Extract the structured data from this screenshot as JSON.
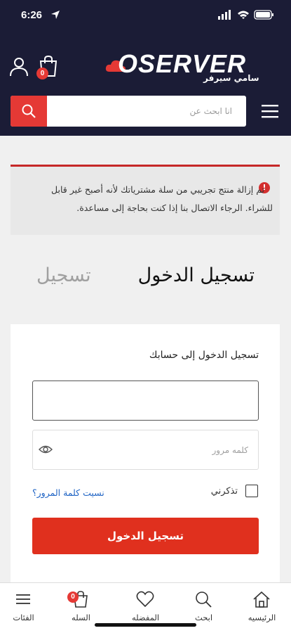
{
  "status_bar": {
    "time": "6:26"
  },
  "header": {
    "logo_text": "OSERVER",
    "logo_subtext": "سامي سيرفر",
    "cart_count": "0",
    "search": {
      "placeholder": "انا ابحث عن"
    },
    "accent_color": "#e53935",
    "bg_color": "#1b1c36"
  },
  "alert": {
    "text": "تم إزالة منتج تجريبي من سلة مشترياتك لأنه أصبح غير قابل للشراء. الرجاء الاتصال بنا إذا كنت بحاجة إلى مساعدة."
  },
  "tabs": {
    "login": "تسجيل الدخول",
    "register": "تسجيل"
  },
  "login_form": {
    "title": "تسجيل الدخول إلى حسابك",
    "username_value": "",
    "password_placeholder": "كلمه مرور",
    "remember_label": "تذكرني",
    "forgot_label": "نسيت كلمة المرور؟",
    "submit_label": "تسجيل الدخول"
  },
  "bottom_nav": {
    "items": [
      {
        "label": "الرئيسيه",
        "icon": "home-icon"
      },
      {
        "label": "ابحث",
        "icon": "search-icon"
      },
      {
        "label": "المفضله",
        "icon": "heart-icon"
      },
      {
        "label": "السله",
        "icon": "cart-icon",
        "badge": "0"
      },
      {
        "label": "الفئات",
        "icon": "menu-icon"
      }
    ]
  }
}
